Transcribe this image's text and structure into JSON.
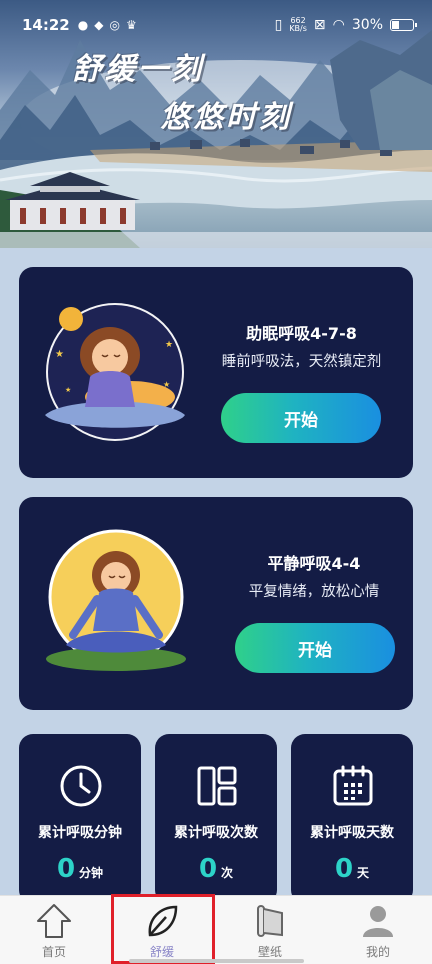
{
  "status_bar": {
    "time": "14:22",
    "net_speed_value": "662",
    "net_speed_unit": "KB/s",
    "battery": "30%"
  },
  "hero": {
    "title_line1": "舒缓一刻",
    "title_line2": "悠悠时刻"
  },
  "cards": [
    {
      "title": "助眠呼吸4-7-8",
      "subtitle": "睡前呼吸法，天然镇定剂",
      "button": "开始"
    },
    {
      "title": "平静呼吸4-4",
      "subtitle": "平复情绪，放松心情",
      "button": "开始"
    }
  ],
  "stats": [
    {
      "label": "累计呼吸分钟",
      "value": "0",
      "unit": "分钟",
      "icon": "clock-icon"
    },
    {
      "label": "累计呼吸次数",
      "value": "0",
      "unit": "次",
      "icon": "layout-grid-icon"
    },
    {
      "label": "累计呼吸天数",
      "value": "0",
      "unit": "天",
      "icon": "calendar-icon"
    }
  ],
  "nav": [
    {
      "label": "首页",
      "icon": "home-icon"
    },
    {
      "label": "舒缓",
      "icon": "leaf-icon"
    },
    {
      "label": "壁纸",
      "icon": "scroll-icon"
    },
    {
      "label": "我的",
      "icon": "user-icon"
    }
  ],
  "colors": {
    "card_bg": "#141c45",
    "accent_teal": "#2dd3c8",
    "button_gradient_start": "#2fd08a",
    "button_gradient_end": "#1a8fe0",
    "nav_active": "#8a86c8"
  }
}
